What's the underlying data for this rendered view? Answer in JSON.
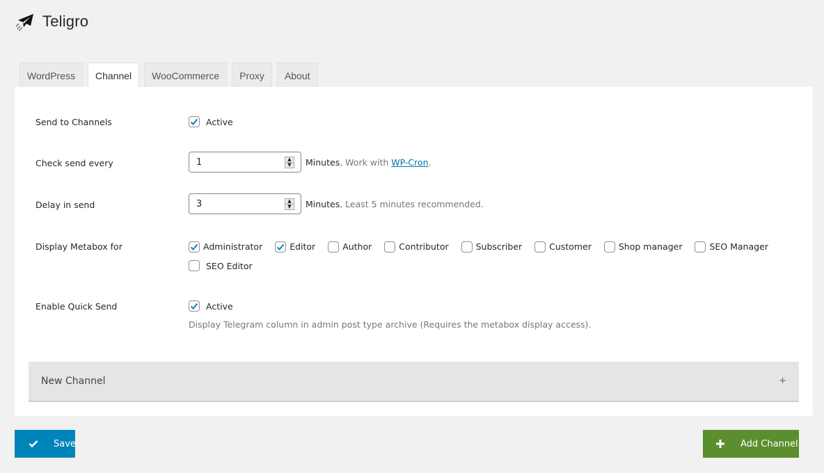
{
  "app": {
    "title": "Teligro",
    "logo_icon": "paper-plane-icon"
  },
  "tabs": [
    {
      "label": "WordPress",
      "active": false
    },
    {
      "label": "Channel",
      "active": true
    },
    {
      "label": "WooCommerce",
      "active": false
    },
    {
      "label": "Proxy",
      "active": false
    },
    {
      "label": "About",
      "active": false
    }
  ],
  "settings": {
    "send_to_channels": {
      "label": "Send to Channels",
      "checkbox_label": "Active",
      "checked": true
    },
    "check_send_every": {
      "label": "Check send every",
      "value": "1",
      "unit": "Minutes",
      "note_prefix": ", Work with ",
      "link_text": "WP-Cron",
      "note_suffix": "."
    },
    "delay_in_send": {
      "label": "Delay in send",
      "value": "3",
      "unit": "Minutes",
      "note": ", Least 5 minutes recommended."
    },
    "display_metabox_for": {
      "label": "Display Metabox for",
      "roles": [
        {
          "label": "Administrator",
          "checked": true
        },
        {
          "label": "Editor",
          "checked": true
        },
        {
          "label": "Author",
          "checked": false
        },
        {
          "label": "Contributor",
          "checked": false
        },
        {
          "label": "Subscriber",
          "checked": false
        },
        {
          "label": "Customer",
          "checked": false
        },
        {
          "label": "Shop manager",
          "checked": false
        },
        {
          "label": "SEO Manager",
          "checked": false
        },
        {
          "label": "SEO Editor",
          "checked": false
        }
      ]
    },
    "enable_quick_send": {
      "label": "Enable Quick Send",
      "checkbox_label": "Active",
      "checked": true,
      "description": "Display Telegram column in admin post type archive (Requires the metabox display access)."
    }
  },
  "accordion": {
    "title": "New Channel",
    "toggle_symbol": "+"
  },
  "buttons": {
    "save_label": "Save",
    "add_channel_label": "Add Channel"
  },
  "colors": {
    "save_button": "#0085ba",
    "add_button": "#5b8e2e",
    "link": "#0073aa",
    "check": "#1e8cbe"
  }
}
